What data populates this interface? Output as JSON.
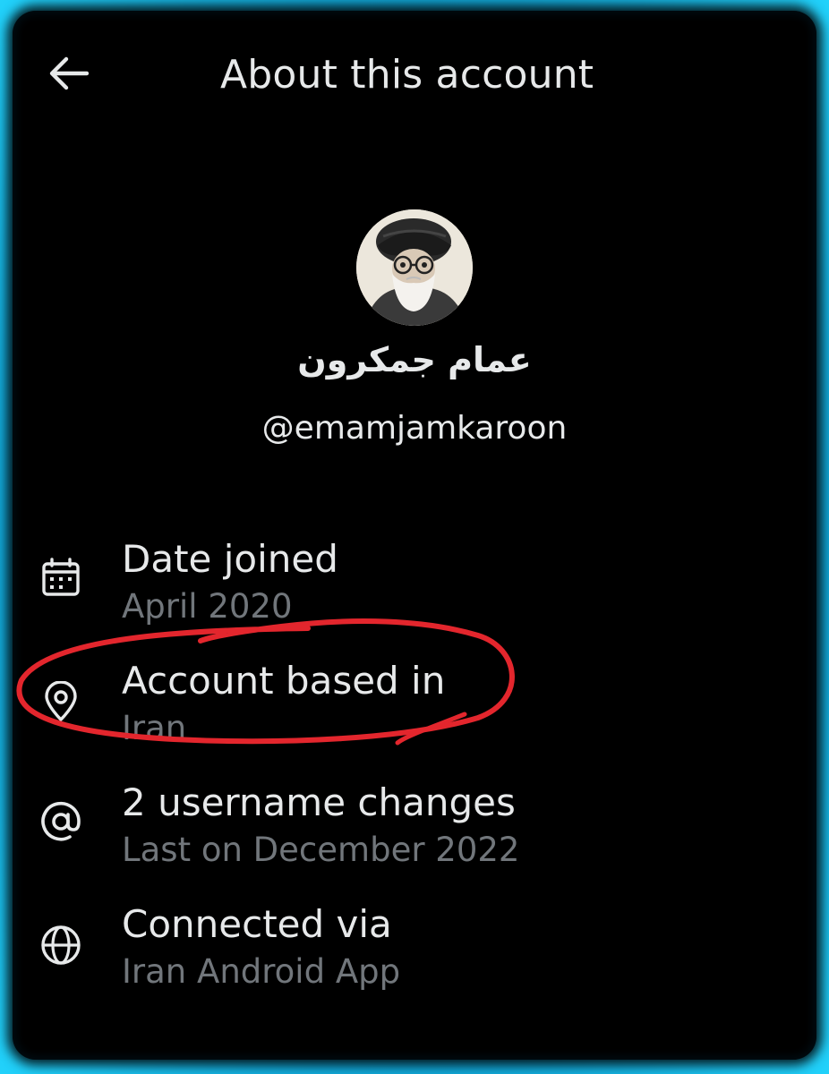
{
  "header": {
    "title": "About this account",
    "back_icon": "arrow-left-icon"
  },
  "profile": {
    "display_name": "عمام جمکرون",
    "handle": "@emamjamkaroon"
  },
  "details": [
    {
      "icon": "calendar-icon",
      "label": "Date joined",
      "value": "April 2020"
    },
    {
      "icon": "location-pin-icon",
      "label": "Account based in",
      "value": "Iran"
    },
    {
      "icon": "at-sign-icon",
      "label": "2 username changes",
      "value": "Last on December 2022"
    },
    {
      "icon": "globe-icon",
      "label": "Connected via",
      "value": "Iran Android App"
    }
  ],
  "colors": {
    "background": "#000000",
    "primary_text": "#e7e9ea",
    "secondary_text": "#71767b",
    "frame_glow": "#18c6f2",
    "annotation": "#e3262d"
  }
}
